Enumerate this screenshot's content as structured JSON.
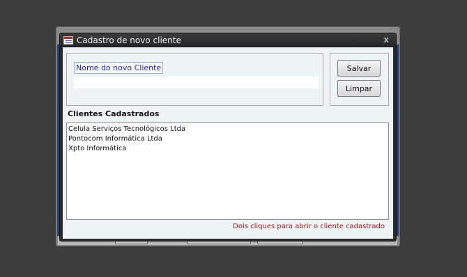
{
  "dialog": {
    "title": "Cadastro de novo cliente",
    "close_label": "x"
  },
  "form": {
    "name_label": "Nome do novo Cliente",
    "name_value": "",
    "save_label": "Salvar",
    "clear_label": "Limpar"
  },
  "clients": {
    "heading": "Clientes Cadastrados",
    "items": [
      "Celula Serviços Tecnológicos Ltda",
      "Pontocom Informática Ltda",
      "Xpto Informática"
    ],
    "hint": "Dois cliques para abrir o cliente cadastrado"
  },
  "colors": {
    "label_text": "#1f1fb8",
    "hint_text": "#a01818",
    "panel_background": "#eef3f6"
  }
}
